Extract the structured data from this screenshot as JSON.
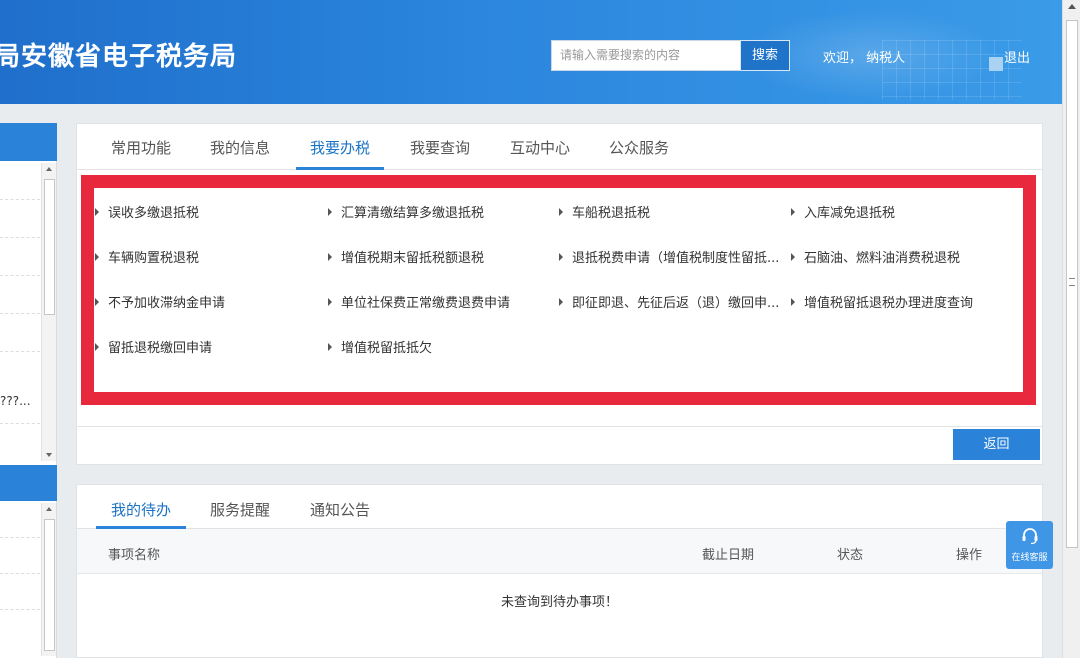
{
  "header": {
    "title": "局安徽省电子税务局",
    "search_placeholder": "请输入需要搜索的内容",
    "search_label": "搜索",
    "welcome": "欢迎， 纳税人",
    "logout": "退出"
  },
  "left_panel": {
    "truncated_text": "???..."
  },
  "tabs": [
    {
      "label": "常用功能"
    },
    {
      "label": "我的信息"
    },
    {
      "label": "我要办税"
    },
    {
      "label": "我要查询"
    },
    {
      "label": "互动中心"
    },
    {
      "label": "公众服务"
    }
  ],
  "active_tab": "我要办税",
  "items": [
    {
      "label": "误收多缴退抵税"
    },
    {
      "label": "汇算清缴结算多缴退抵税"
    },
    {
      "label": "车船税退抵税"
    },
    {
      "label": "入库减免退抵税"
    },
    {
      "label": "车辆购置税退税"
    },
    {
      "label": "增值税期末留抵税额退税"
    },
    {
      "label": "退抵税费申请（增值税制度性留抵..."
    },
    {
      "label": "石脑油、燃料油消费税退税"
    },
    {
      "label": "不予加收滞纳金申请"
    },
    {
      "label": "单位社保费正常缴费退费申请"
    },
    {
      "label": "即征即退、先征后返（退）缴回申..."
    },
    {
      "label": "增值税留抵退税办理进度查询"
    },
    {
      "label": "留抵退税缴回申请"
    },
    {
      "label": "增值税留抵抵欠"
    }
  ],
  "back_button": "返回",
  "bottom_tabs": [
    {
      "label": "我的待办"
    },
    {
      "label": "服务提醒"
    },
    {
      "label": "通知公告"
    }
  ],
  "table_headers": {
    "name": "事项名称",
    "deadline": "截止日期",
    "status": "状态",
    "action": "操作"
  },
  "empty_message": "未查询到待办事项！",
  "chat": {
    "label": "在线客服"
  },
  "colors": {
    "header_blue": "#2b86dd",
    "accent": "#2a83d9",
    "highlight_red": "#e8293d"
  }
}
